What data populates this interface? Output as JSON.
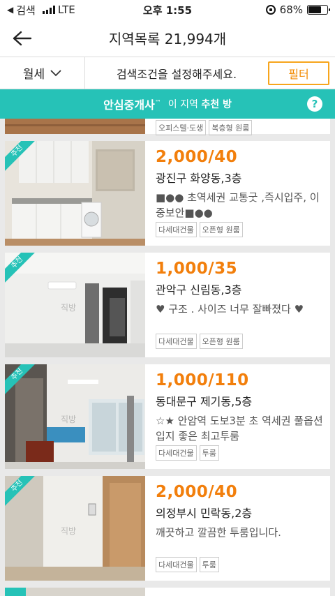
{
  "status_bar": {
    "back_app": "검색",
    "network": "LTE",
    "time": "오후 1:55",
    "battery": "68%",
    "battery_level": 0.68
  },
  "header": {
    "title": "지역목록 21,994개"
  },
  "filter": {
    "rent_type": "월세",
    "hint": "검색조건을 설정해주세요.",
    "button": "필터"
  },
  "banner": {
    "brand": "안심중개사",
    "brand_mark": "™",
    "prefix": "이 지역",
    "highlight": "추천 방",
    "help": "?"
  },
  "partial_card": {
    "tags": [
      "오피스텔·도생",
      "복층형 원룸"
    ]
  },
  "listings": [
    {
      "badge": "추천",
      "price": "2,000/40",
      "location": "광진구 화양동,3층",
      "description": "■●●   초역세권 교통굿 ,즉시입주,  이중보안■●●",
      "tags": [
        "다세대건물",
        "오픈형 원룸"
      ],
      "watermark": ""
    },
    {
      "badge": "추천",
      "price": "1,000/35",
      "location": "관악구 신림동,3층",
      "description": "♥ 구조 . 사이즈 너무 잘빠졌다 ♥",
      "tags": [
        "다세대건물",
        "오픈형 원룸"
      ],
      "watermark": "직방"
    },
    {
      "badge": "추천",
      "price": "1,000/110",
      "location": "동대문구 제기동,5층",
      "description": "☆★ 안암역 도보3분 초 역세권 풀옵션 입지 좋은 최고투룸",
      "tags": [
        "다세대건물",
        "투룸"
      ],
      "watermark": "직방"
    },
    {
      "badge": "추천",
      "price": "2,000/40",
      "location": "의정부시 민락동,2층",
      "description": "깨끗하고 깔끔한 투룸입니다.",
      "tags": [
        "다세대건물",
        "투룸"
      ],
      "watermark": "직방"
    }
  ],
  "colors": {
    "accent_orange": "#f27f0c",
    "banner_teal": "#26c2b7",
    "filter_border": "#f7a51c"
  }
}
